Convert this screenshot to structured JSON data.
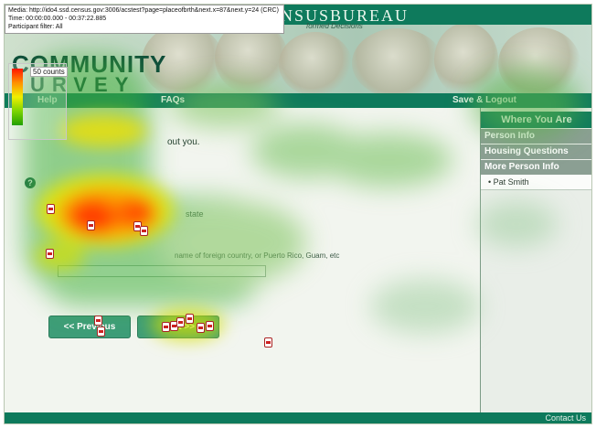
{
  "overlay": {
    "media": "Media: http://ido4.ssd.census.gov:3006/acstest?page=placeofbrth&next.x=87&next.y=24 (CRC)",
    "time": "Time: 00:00:00.000 - 00:37:22.885",
    "filter": "Participant filter: All",
    "legend_label": "50 counts"
  },
  "header": {
    "title": "USCENSUSBUREAU",
    "subtitle": "formed Decisions",
    "logo_line1": "COMMUNITY",
    "logo_line2": "URVEY"
  },
  "nav": {
    "help": "Help",
    "faqs": "FAQs",
    "save_logout": "Save & Logout"
  },
  "sidebar": {
    "title": "Where You Are",
    "items": [
      {
        "label": "Person Info"
      },
      {
        "label": "Housing Questions"
      },
      {
        "label": "More Person Info"
      }
    ],
    "subitem": "• Pat Smith"
  },
  "main": {
    "question_fragment": "out you.",
    "state_fragment": "state",
    "foreign_fragment": "name of foreign country, or Puerto Rico, Guam, etc",
    "previous_label": "<< Previous",
    "next_label": "Next >>",
    "help_icon": "?"
  },
  "footer": {
    "contact": "Contact Us"
  },
  "colors": {
    "census_green": "#0e7a5c",
    "heat_hot": "#ff1400",
    "heat_warm": "#f0f000",
    "heat_cool": "#22a000"
  }
}
